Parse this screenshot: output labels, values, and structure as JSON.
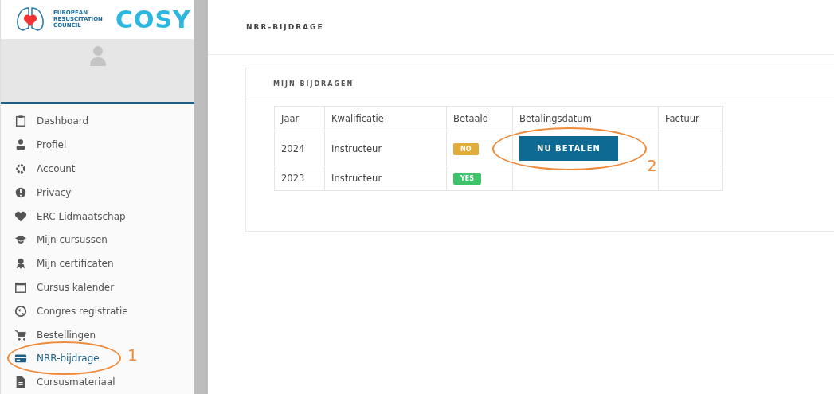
{
  "logo": {
    "org_lines": [
      "EUROPEAN",
      "RESUSCITATION",
      "COUNCIL"
    ],
    "brand": "COSY"
  },
  "sidebar": {
    "items": [
      {
        "label": "Dashboard",
        "selected": false
      },
      {
        "label": "Profiel",
        "selected": false
      },
      {
        "label": "Account",
        "selected": false
      },
      {
        "label": "Privacy",
        "selected": false
      },
      {
        "label": "ERC Lidmaatschap",
        "selected": false
      },
      {
        "label": "Mijn cursussen",
        "selected": false
      },
      {
        "label": "Mijn certificaten",
        "selected": false
      },
      {
        "label": "Cursus kalender",
        "selected": false
      },
      {
        "label": "Congres registratie",
        "selected": false
      },
      {
        "label": "Bestellingen",
        "selected": false
      },
      {
        "label": "NRR-bijdrage",
        "selected": true
      },
      {
        "label": "Cursusmateriaal",
        "selected": false
      }
    ]
  },
  "page_title": "NRR-BIJDRAGE",
  "card": {
    "title": "MIJN BIJDRAGEN",
    "table": {
      "columns": [
        "Jaar",
        "Kwalificatie",
        "Betaald",
        "Betalingsdatum",
        "Factuur"
      ],
      "rows": [
        {
          "year": "2024",
          "qualification": "Instructeur",
          "paid": false,
          "paid_label": "NO",
          "action": "NU BETALEN"
        },
        {
          "year": "2023",
          "qualification": "Instructeur",
          "paid": true,
          "paid_label": "YES"
        }
      ]
    }
  },
  "annotations": [
    {
      "label": "1"
    },
    {
      "label": "2"
    }
  ]
}
